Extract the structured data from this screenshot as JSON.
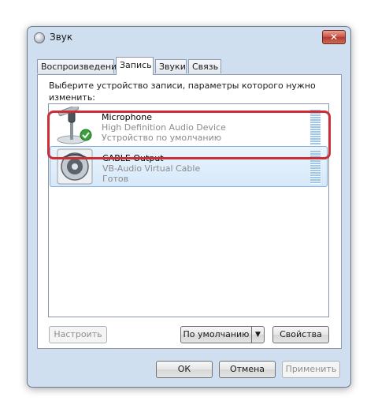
{
  "window": {
    "title": "Звук",
    "close_label": "✕"
  },
  "tabs": [
    {
      "label": "Воспроизведение"
    },
    {
      "label": "Запись"
    },
    {
      "label": "Звуки"
    },
    {
      "label": "Связь"
    }
  ],
  "instructions": "Выберите устройство записи, параметры которого нужно изменить:",
  "devices": [
    {
      "name": "Microphone",
      "description": "High Definition Audio Device",
      "status": "Устройство по умолчанию",
      "icon": "microphone-icon",
      "is_default": true,
      "selected": false
    },
    {
      "name": "CABLE Output",
      "description": "VB-Audio Virtual Cable",
      "status": "Готов",
      "icon": "cable-output-icon",
      "is_default": false,
      "selected": true
    }
  ],
  "buttons": {
    "configure": "Настроить",
    "set_default": "По умолчанию",
    "properties": "Свойства",
    "ok": "ОК",
    "cancel": "Отмена",
    "apply": "Применить"
  },
  "colors": {
    "highlight": "#cc2e35",
    "selection": "#d6e9fa",
    "default_check": "#3aa03a"
  }
}
